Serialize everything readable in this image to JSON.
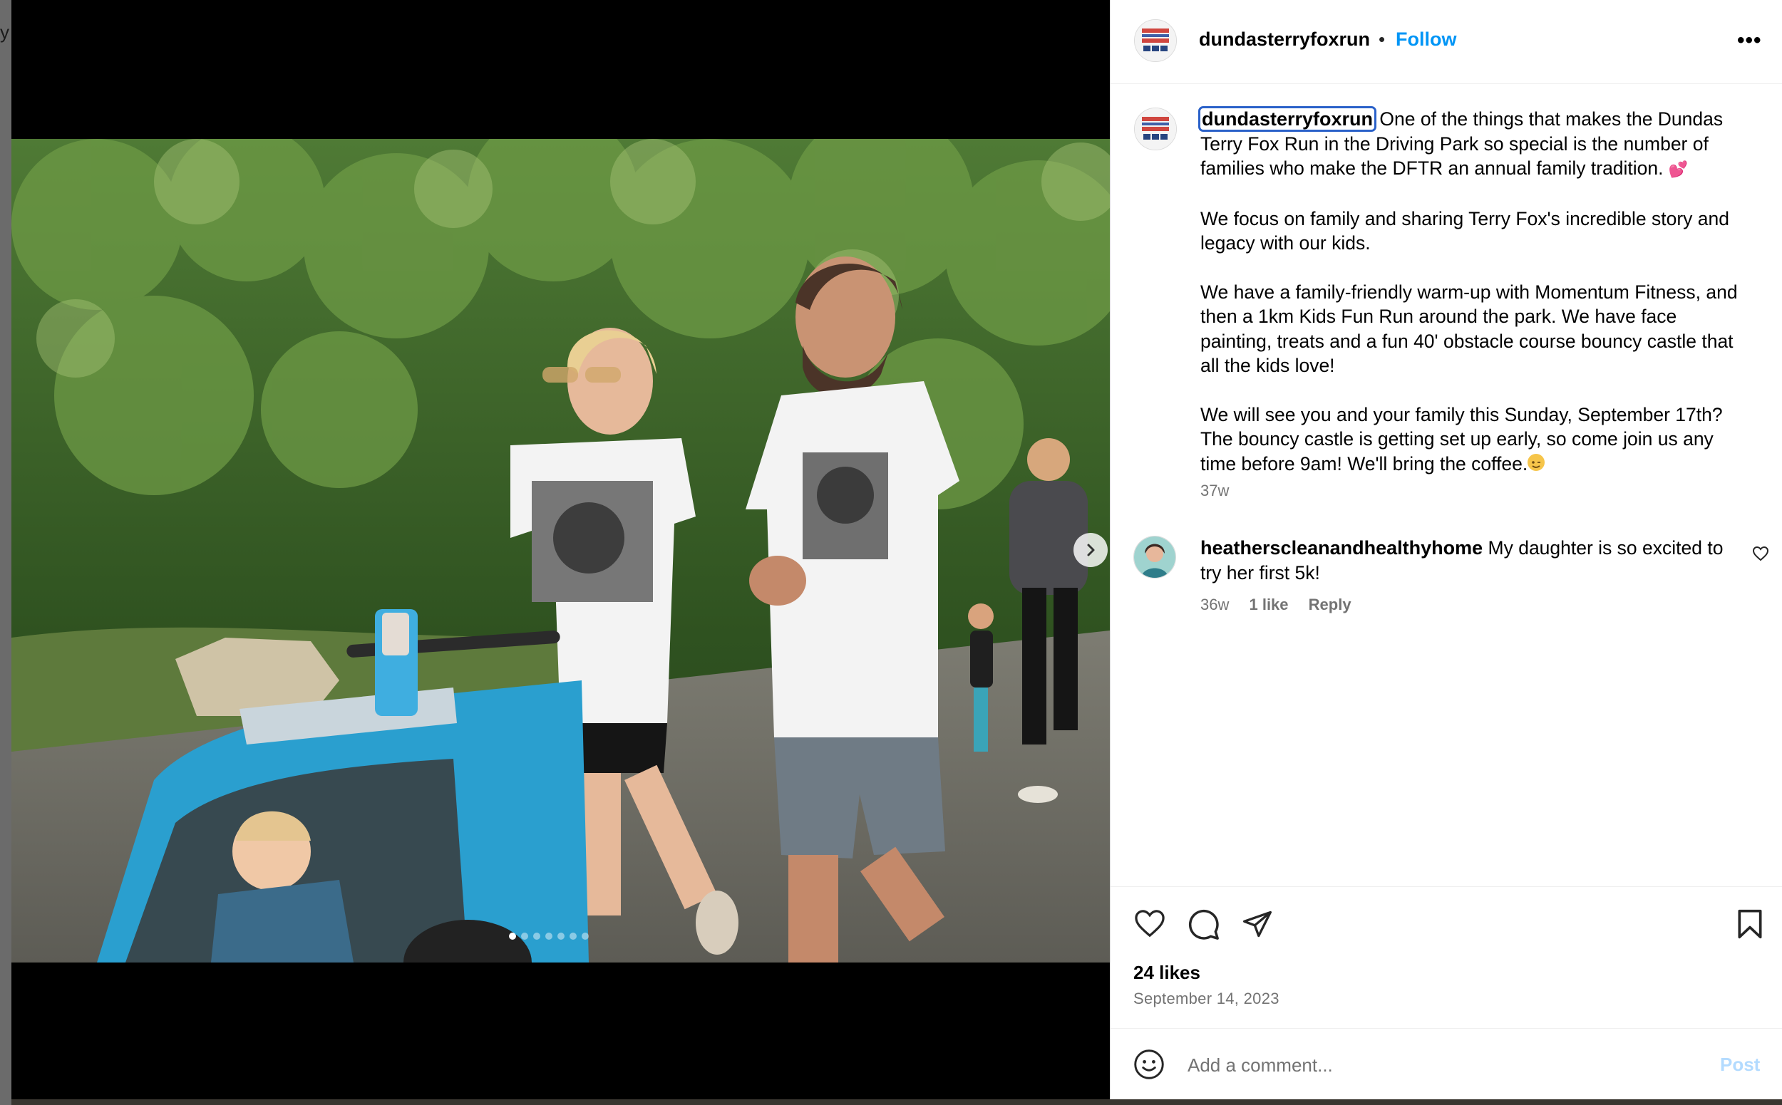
{
  "post": {
    "account": "dundasterryfoxrun",
    "separator": "•",
    "follow_label": "Follow",
    "more_label": "•••",
    "caption": {
      "username": "dundasterryfoxrun",
      "paragraph1": "One of the things that makes the Dundas Terry Fox Run in the Driving Park so special is the number of families who make the DFTR an annual family tradition.",
      "paragraph1_emoji": "💕",
      "paragraph2": "We focus on family and sharing Terry Fox's incredible story and legacy with our kids.",
      "paragraph3": "We have a family-friendly warm-up with Momentum Fitness, and then a 1km Kids Fun Run around the park. We have face painting, treats and a fun 40' obstacle course bouncy castle that all the kids love!",
      "paragraph4": "We will see you and your family this Sunday, September 17th? The bouncy castle is getting set up early, so come join us any time before 9am! We'll bring the coffee.",
      "paragraph4_emoji": "wink-emoji",
      "time": "37w"
    },
    "comment": {
      "username": "heatherscleanandhealthyhome",
      "text": "My daughter is so excited to try her first 5k!",
      "time": "36w",
      "likes": "1 like",
      "reply_label": "Reply"
    },
    "likes": "24 likes",
    "date": "September 14, 2023",
    "add_comment_placeholder": "Add a comment...",
    "post_label": "Post",
    "carousel": {
      "count": 7,
      "active": 0
    },
    "colors": {
      "link_blue": "#0095f6",
      "muted": "#737373",
      "post_disabled": "#b3dbff"
    }
  }
}
